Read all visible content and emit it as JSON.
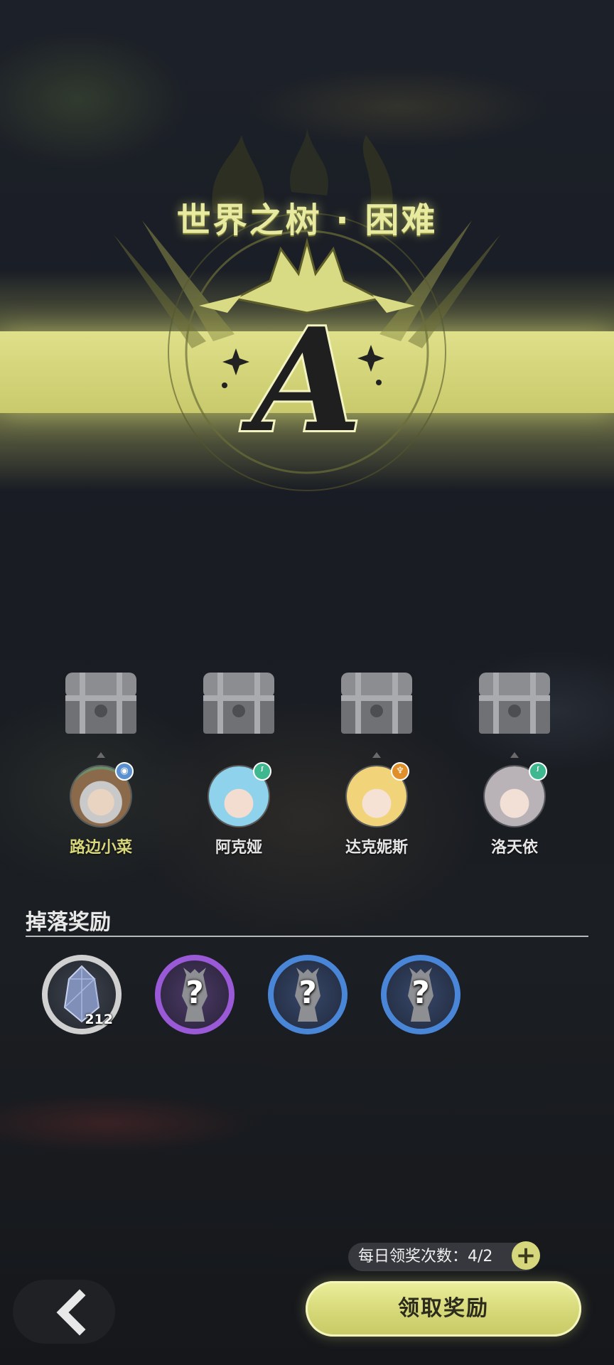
{
  "stage": {
    "title": "世界之树 · 困难",
    "rank": "A"
  },
  "team": [
    {
      "name": "路边小菜",
      "highlight": true,
      "badge_color": "#5a8fd0",
      "badge_icon": "water-icon"
    },
    {
      "name": "阿克娅",
      "highlight": false,
      "badge_color": "#3fb88f",
      "badge_icon": "wind-icon"
    },
    {
      "name": "达克妮斯",
      "highlight": false,
      "badge_color": "#e0902a",
      "badge_icon": "fire-icon"
    },
    {
      "name": "洛天依",
      "highlight": false,
      "badge_color": "#3fb88f",
      "badge_icon": "wind-icon"
    }
  ],
  "drops": {
    "title": "掉落奖励",
    "items": [
      {
        "type": "crystal",
        "count": "212",
        "ring_color": "#c8c8c8"
      },
      {
        "type": "unknown",
        "label": "?",
        "ring_color": "#9a5ad8"
      },
      {
        "type": "unknown",
        "label": "?",
        "ring_color": "#4a86d8"
      },
      {
        "type": "unknown",
        "label": "?",
        "ring_color": "#4a86d8"
      }
    ]
  },
  "daily_claims": {
    "label": "每日领奖次数：",
    "value": "4/2"
  },
  "buttons": {
    "claim": "领取奖励",
    "plus": "+"
  },
  "colors": {
    "accent": "#d6d77c",
    "banner": "#d4d47a",
    "title": "#e8eaa0"
  }
}
